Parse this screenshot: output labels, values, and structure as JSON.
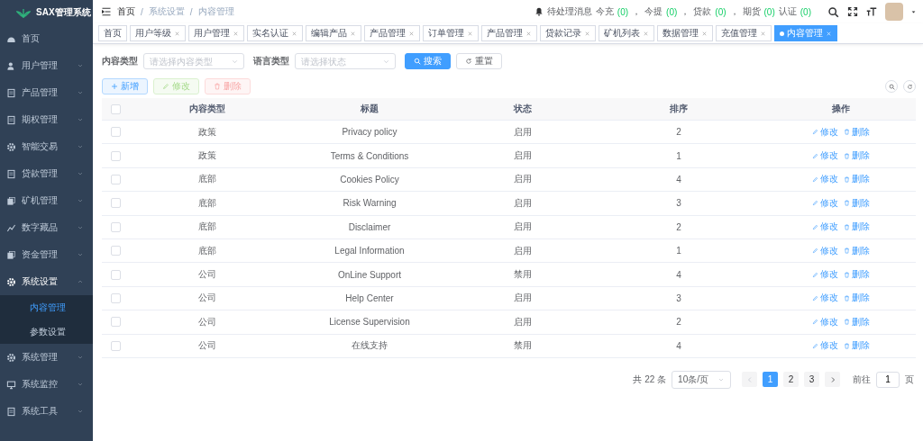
{
  "sidebar": {
    "logo_text": "SAX管理系统",
    "items": [
      {
        "label": "首页",
        "expanded": false,
        "has_children": false
      },
      {
        "label": "用户管理",
        "expanded": false,
        "has_children": true
      },
      {
        "label": "产品管理",
        "expanded": false,
        "has_children": true
      },
      {
        "label": "期权管理",
        "expanded": false,
        "has_children": true
      },
      {
        "label": "智能交易",
        "expanded": false,
        "has_children": true
      },
      {
        "label": "贷款管理",
        "expanded": false,
        "has_children": true
      },
      {
        "label": "矿机管理",
        "expanded": false,
        "has_children": true
      },
      {
        "label": "数字藏品",
        "expanded": false,
        "has_children": true
      },
      {
        "label": "资金管理",
        "expanded": false,
        "has_children": true
      },
      {
        "label": "系统设置",
        "expanded": true,
        "has_children": true,
        "children": [
          {
            "label": "内容管理",
            "selected": true
          },
          {
            "label": "参数设置",
            "selected": false
          }
        ]
      },
      {
        "label": "系统管理",
        "expanded": false,
        "has_children": true
      },
      {
        "label": "系统监控",
        "expanded": false,
        "has_children": true
      },
      {
        "label": "系统工具",
        "expanded": false,
        "has_children": true
      }
    ]
  },
  "header": {
    "breadcrumb": {
      "items": [
        "首页",
        "系统设置",
        "内容管理"
      ],
      "separator": "/"
    },
    "notices": {
      "title": "待处理消息",
      "counters": [
        {
          "label": "今充",
          "count": "(0)",
          "separator": "，"
        },
        {
          "label": "今提",
          "count": "(0)",
          "separator": "，"
        },
        {
          "label": "贷款",
          "count": "(0)",
          "separator": "，"
        },
        {
          "label": "期货",
          "count": "(0)"
        },
        {
          "label": "认证",
          "count": "(0)"
        }
      ]
    }
  },
  "tags": [
    {
      "label": "首页",
      "selected": false,
      "closable": false
    },
    {
      "label": "用户等级",
      "selected": false,
      "closable": true
    },
    {
      "label": "用户管理",
      "selected": false,
      "closable": true
    },
    {
      "label": "实名认证",
      "selected": false,
      "closable": true
    },
    {
      "label": "编辑产品",
      "selected": false,
      "closable": true
    },
    {
      "label": "产品管理",
      "selected": false,
      "closable": true
    },
    {
      "label": "订单管理",
      "selected": false,
      "closable": true
    },
    {
      "label": "产品管理",
      "selected": false,
      "closable": true
    },
    {
      "label": "贷款记录",
      "selected": false,
      "closable": true
    },
    {
      "label": "矿机列表",
      "selected": false,
      "closable": true
    },
    {
      "label": "数据管理",
      "selected": false,
      "closable": true
    },
    {
      "label": "充值管理",
      "selected": false,
      "closable": true
    },
    {
      "label": "内容管理",
      "selected": true,
      "closable": true
    }
  ],
  "filters": [
    {
      "label": "内容类型",
      "placeholder": "请选择内容类型"
    },
    {
      "label": "语言类型",
      "placeholder": "请选择状态"
    }
  ],
  "filter_buttons": [
    {
      "label": "搜索",
      "kind": "primary"
    },
    {
      "label": "重置",
      "kind": "plain"
    }
  ],
  "toolbar": [
    {
      "label": "新增",
      "kind": "primary",
      "disabled": false
    },
    {
      "label": "修改",
      "kind": "success",
      "disabled": true
    },
    {
      "label": "删除",
      "kind": "danger",
      "disabled": true
    }
  ],
  "table": {
    "columns": [
      "内容类型",
      "标题",
      "状态",
      "排序",
      "操作"
    ],
    "all_checked": false,
    "rows": [
      {
        "type": "政策",
        "title": "Privacy policy",
        "status": "启用",
        "sort": "2",
        "checked": false,
        "actions": [
          "修改",
          "删除"
        ]
      },
      {
        "type": "政策",
        "title": "Terms & Conditions",
        "status": "启用",
        "sort": "1",
        "checked": false,
        "actions": [
          "修改",
          "删除"
        ]
      },
      {
        "type": "底部",
        "title": "Cookies Policy",
        "status": "启用",
        "sort": "4",
        "checked": false,
        "actions": [
          "修改",
          "删除"
        ]
      },
      {
        "type": "底部",
        "title": "Risk Warning",
        "status": "启用",
        "sort": "3",
        "checked": false,
        "actions": [
          "修改",
          "删除"
        ]
      },
      {
        "type": "底部",
        "title": "Disclaimer",
        "status": "启用",
        "sort": "2",
        "checked": false,
        "actions": [
          "修改",
          "删除"
        ]
      },
      {
        "type": "底部",
        "title": "Legal Information",
        "status": "启用",
        "sort": "1",
        "checked": false,
        "actions": [
          "修改",
          "删除"
        ]
      },
      {
        "type": "公司",
        "title": "OnLine Support",
        "status": "禁用",
        "sort": "4",
        "checked": false,
        "actions": [
          "修改",
          "删除"
        ]
      },
      {
        "type": "公司",
        "title": "Help Center",
        "status": "启用",
        "sort": "3",
        "checked": false,
        "actions": [
          "修改",
          "删除"
        ]
      },
      {
        "type": "公司",
        "title": "License Supervision",
        "status": "启用",
        "sort": "2",
        "checked": false,
        "actions": [
          "修改",
          "删除"
        ]
      },
      {
        "type": "公司",
        "title": "在线支持",
        "status": "禁用",
        "sort": "4",
        "checked": false,
        "actions": [
          "修改",
          "删除"
        ]
      }
    ]
  },
  "pagination": {
    "total": "共 22 条",
    "page_size": "10条/页",
    "pages": [
      {
        "label": "1",
        "selected": true
      },
      {
        "label": "2",
        "selected": false
      },
      {
        "label": "3",
        "selected": false
      }
    ],
    "goto_label": "前往",
    "goto_value": "1",
    "goto_suffix": "页"
  }
}
